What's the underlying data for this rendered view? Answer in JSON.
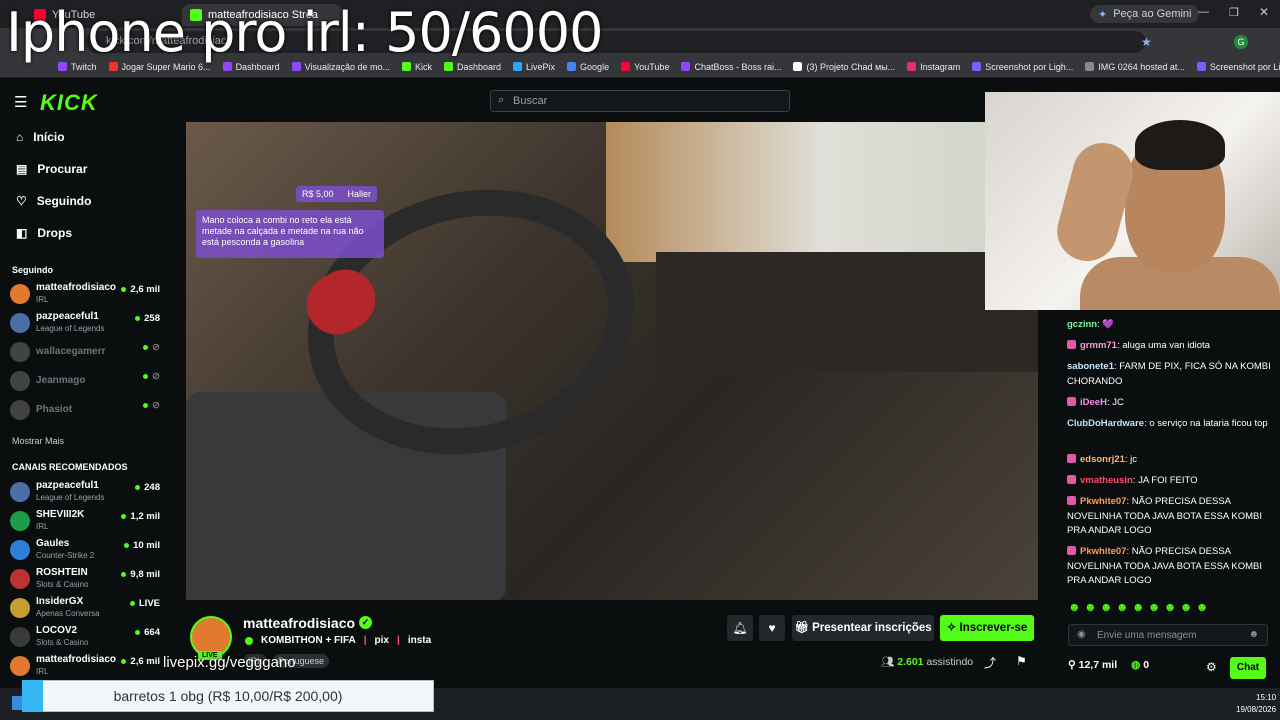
{
  "overlay": {
    "title": "Iphone pro irl: 50/6000",
    "livepix_text": "livepix.gg/vegggano",
    "goal_text": "barretos 1 obg (R$ 10,00/R$ 200,00)",
    "goal_progress": 0.05
  },
  "browser": {
    "tabs": [
      {
        "label": "YouTube",
        "color": "#ff0033"
      },
      {
        "label": "matteafrodisiaco Stream",
        "color": "#53fc18"
      }
    ],
    "address": "kick.com/matteafrodisiaco",
    "gemini": "Peça ao Gemini",
    "bookmarks": [
      {
        "label": "Twitch",
        "color": "#9146ff"
      },
      {
        "label": "Jogar Super Mario 6...",
        "color": "#e33"
      },
      {
        "label": "Dashboard",
        "color": "#9146ff"
      },
      {
        "label": "Visualização de mo...",
        "color": "#9146ff"
      },
      {
        "label": "Kick",
        "color": "#53fc18"
      },
      {
        "label": "Dashboard",
        "color": "#53fc18"
      },
      {
        "label": "LivePix",
        "color": "#2aa8ff"
      },
      {
        "label": "Google",
        "color": "#4285f4"
      },
      {
        "label": "YouTube",
        "color": "#ff0033"
      },
      {
        "label": "ChatBoss - Boss rai...",
        "color": "#9146ff"
      },
      {
        "label": "(3) Projeto Chad мы...",
        "color": "#fff"
      },
      {
        "label": "Instagram",
        "color": "#e1306c"
      },
      {
        "label": "Screenshot por Ligh...",
        "color": "#7b5cff"
      },
      {
        "label": "IMG 0264 hosted at...",
        "color": "#888"
      },
      {
        "label": "Screenshot por Ligh...",
        "color": "#7b5cff"
      }
    ]
  },
  "header": {
    "logo": "KICK",
    "search_placeholder": "Buscar"
  },
  "sidebar": {
    "nav": [
      {
        "label": "Início",
        "icon": "home-icon",
        "glyph": "⌂"
      },
      {
        "label": "Procurar",
        "icon": "browse-icon",
        "glyph": "▤"
      },
      {
        "label": "Seguindo",
        "icon": "heart-icon",
        "glyph": "♡"
      },
      {
        "label": "Drops",
        "icon": "drops-icon",
        "glyph": "◧"
      }
    ],
    "following_title": "Seguindo",
    "following": [
      {
        "name": "matteafrodisiaco",
        "category": "IRL",
        "viewers": "2,6 mil",
        "online": true
      },
      {
        "name": "pazpeaceful1",
        "category": "League of Legends",
        "viewers": "258",
        "online": true
      },
      {
        "name": "wallacegamerr",
        "category": "",
        "viewers": "",
        "online": false
      },
      {
        "name": "Jeanmago",
        "category": "",
        "viewers": "",
        "online": false
      },
      {
        "name": "Phasiot",
        "category": "",
        "viewers": "",
        "online": false
      }
    ],
    "show_more": "Mostrar Mais",
    "recommended_title": "CANAIS RECOMENDADOS",
    "recommended": [
      {
        "name": "pazpeaceful1",
        "category": "League of Legends",
        "viewers": "248"
      },
      {
        "name": "SHEVIII2K",
        "category": "IRL",
        "viewers": "1,2 mil"
      },
      {
        "name": "Gaules",
        "category": "Counter-Strike 2",
        "viewers": "10 mil"
      },
      {
        "name": "ROSHTEIN",
        "category": "Slots & Casino",
        "viewers": "9,8 mil"
      },
      {
        "name": "InsiderGX",
        "category": "Apenas Conversa",
        "viewers": "LIVE"
      },
      {
        "name": "LOCOV2",
        "category": "Slots & Casino",
        "viewers": "664"
      },
      {
        "name": "matteafrodisiaco",
        "category": "IRL",
        "viewers": "2,6 mil"
      }
    ]
  },
  "video": {
    "donation_amount": "R$ 5,00",
    "donation_user": "Haller",
    "donation_message": "Mano coloca a combi no reto ela está metade na calçada e metade na rua não está pesconda a gasolina"
  },
  "stream": {
    "streamer": "matteafrodisiaco",
    "live_badge": "LIVE",
    "title_parts": [
      "KOMBITHON + FIFA",
      "pix",
      "insta"
    ],
    "tags": [
      "IRL",
      "Portuguese"
    ],
    "gift_label": "Presentear inscrições",
    "subscribe_label": "Inscrever-se",
    "viewers_count": "2.601",
    "viewers_label": "assistindo"
  },
  "chat": {
    "messages": [
      {
        "user": "gczinn",
        "text": "💜",
        "color": "#7cf7a0",
        "badge": false
      },
      {
        "user": "grmm71",
        "text": "aluga uma van idiota",
        "color": "#ff9bd2",
        "badge": true
      },
      {
        "user": "sabonete1",
        "text": "FARM DE PIX, FICA SÓ NA KOMBI CHORANDO",
        "color": "#c7e5ff",
        "badge": false
      },
      {
        "user": "iDeeH",
        "text": "JC",
        "color": "#ff8cf0",
        "badge": true
      },
      {
        "user": "ClubDoHardware",
        "text": "o serviço na lataria ficou top",
        "color": "#bfe3ff",
        "badge": false
      },
      {
        "user": "edsonrj21",
        "text": "jc",
        "color": "#ffb36b",
        "badge": true
      },
      {
        "user": "vmatheusin",
        "text": "JA FOI FEITO",
        "color": "#ff4d6d",
        "badge": true
      },
      {
        "user": "Pkwhite07",
        "text": "NÃO PRECISA DESSA NOVELINHA TODA JAVA BOTA ESSA KOMBI PRA ANDAR LOGO",
        "color": "#ff9b5e",
        "badge": true
      },
      {
        "user": "Pkwhite07",
        "text": "NÃO PRECISA DESSA NOVELINHA TODA JAVA BOTA ESSA KOMBI PRA ANDAR LOGO",
        "color": "#ff9b5e",
        "badge": true
      }
    ],
    "input_placeholder": "Envie uma mensagem",
    "followers": "12,7 mil",
    "kicks": "0",
    "chat_button": "Chat"
  },
  "taskbar": {
    "time": "15:10",
    "date": "19/08/2026"
  }
}
